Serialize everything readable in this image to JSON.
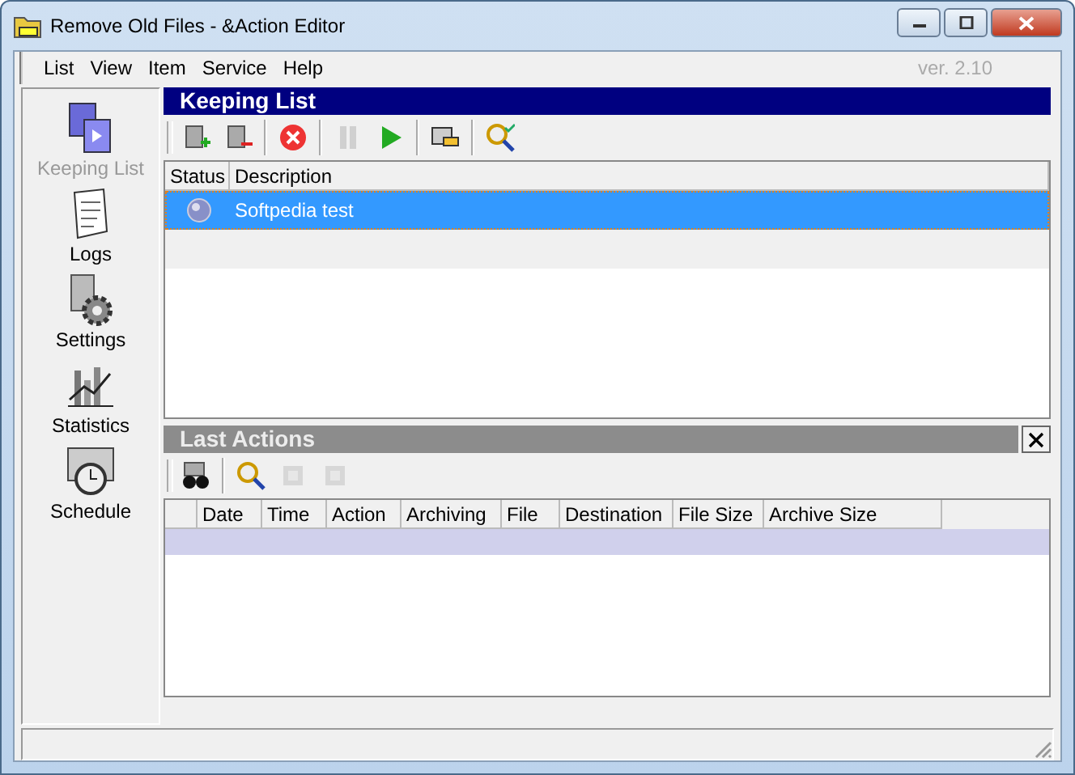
{
  "window": {
    "title": "Remove Old Files - &Action Editor"
  },
  "menu": [
    "List",
    "View",
    "Item",
    "Service",
    "Help"
  ],
  "version": "ver. 2.10",
  "sidebar": {
    "items": [
      {
        "kind": "lists",
        "label": "Keeping List",
        "selected": true
      },
      {
        "kind": "logs",
        "label": "Logs",
        "selected": false
      },
      {
        "kind": "settings",
        "label": "Settings",
        "selected": false
      },
      {
        "kind": "statistics",
        "label": "Statistics",
        "selected": false
      },
      {
        "kind": "schedule",
        "label": "Schedule",
        "selected": false
      }
    ]
  },
  "keeping": {
    "title": "Keeping List",
    "toolbar": [
      {
        "kind": "add",
        "disabled": false
      },
      {
        "kind": "remove",
        "disabled": false
      },
      {
        "kind": "delete",
        "disabled": false
      },
      {
        "kind": "pause",
        "disabled": true
      },
      {
        "kind": "play",
        "disabled": false
      },
      {
        "kind": "hand",
        "disabled": false
      },
      {
        "kind": "check",
        "disabled": false
      }
    ],
    "columns": [
      "Status",
      "Description"
    ],
    "rows": [
      {
        "description": "Softpedia test",
        "selected": true
      }
    ]
  },
  "last_actions": {
    "title": "Last Actions",
    "toolbar": [
      {
        "kind": "binoculars",
        "disabled": false
      },
      {
        "kind": "check",
        "disabled": false
      },
      {
        "kind": "doc",
        "disabled": true
      },
      {
        "kind": "doc",
        "disabled": true
      }
    ],
    "columns": [
      "Date",
      "Time",
      "Action",
      "Archiving",
      "File",
      "Destination",
      "File Size",
      "Archive Size"
    ]
  }
}
